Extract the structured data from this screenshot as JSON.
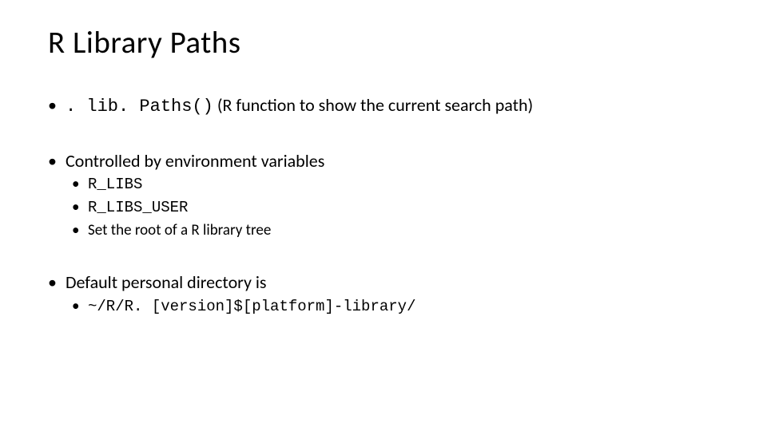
{
  "slide": {
    "title": "R Library Paths",
    "bullets": [
      {
        "code": ". lib. Paths()",
        "text_after": " (R function to show the current search path)"
      },
      {
        "label": "Controlled by environment variables",
        "subs": [
          {
            "code": "R_LIBS"
          },
          {
            "code": "R_LIBS_USER"
          },
          {
            "text": "Set the root of a R library tree"
          }
        ]
      },
      {
        "label": "Default personal directory is",
        "subs": [
          {
            "code": "~/R/R. [version]$[platform]-library/"
          }
        ]
      }
    ]
  }
}
